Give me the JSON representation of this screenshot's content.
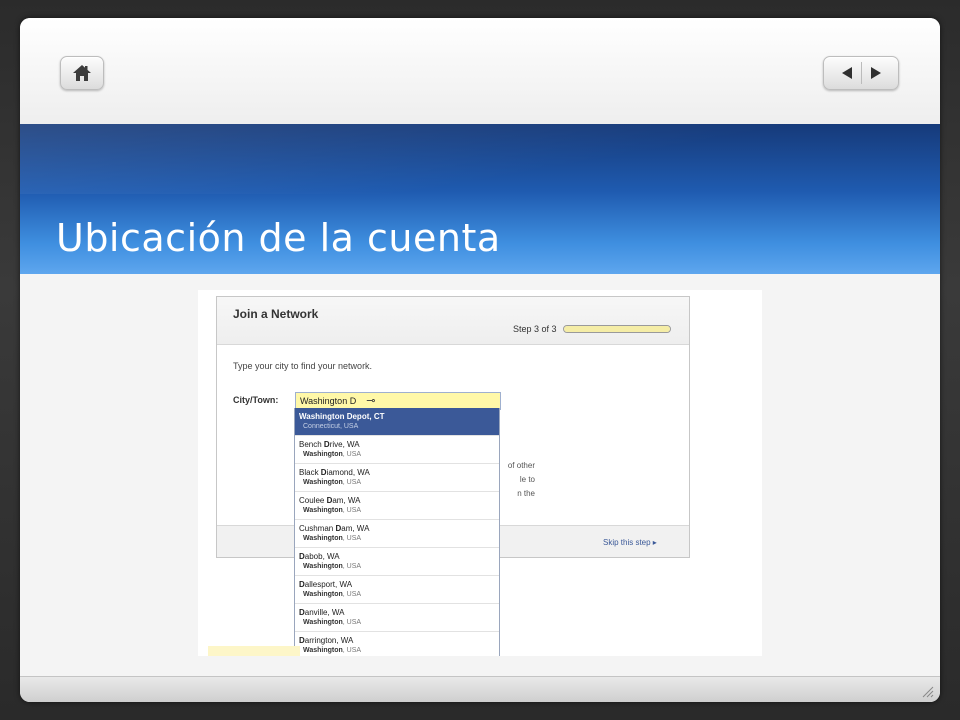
{
  "slide": {
    "title": "Ubicación de la cuenta",
    "colors": {
      "title_band": "#1f5bb0",
      "title_text": "#ffffff",
      "frame": "#2b2b2b"
    }
  },
  "nav": {
    "home_icon": "home-icon",
    "prev_icon": "triangle-left-icon",
    "next_icon": "triangle-right-icon"
  },
  "screenshot": {
    "panel_title": "Join a Network",
    "step_text": "Step 3 of 3",
    "step_progress": 1.0,
    "instruction": "Type your city to find your network.",
    "city_label": "City/Town:",
    "city_value": "Washington D",
    "behind_text": [
      "of other",
      "le to",
      "n the"
    ],
    "skip_label": "Skip this step ▸",
    "suggestions": [
      {
        "name_bold": "Washington D",
        "name_rest": "epot, CT",
        "sub_bold": "",
        "sub_rest": "Connecticut, USA",
        "selected": true
      },
      {
        "name_pre": "Bench ",
        "name_bold": "D",
        "name_rest": "rive, WA",
        "sub_bold": "Washington",
        "sub_rest": ", USA"
      },
      {
        "name_pre": "Black ",
        "name_bold": "D",
        "name_rest": "iamond, WA",
        "sub_bold": "Washington",
        "sub_rest": ", USA"
      },
      {
        "name_pre": "Coulee ",
        "name_bold": "D",
        "name_rest": "am, WA",
        "sub_bold": "Washington",
        "sub_rest": ", USA"
      },
      {
        "name_pre": "Cushman ",
        "name_bold": "D",
        "name_rest": "am, WA",
        "sub_bold": "Washington",
        "sub_rest": ", USA"
      },
      {
        "name_pre": "",
        "name_bold": "D",
        "name_rest": "abob, WA",
        "sub_bold": "Washington",
        "sub_rest": ", USA"
      },
      {
        "name_pre": "",
        "name_bold": "D",
        "name_rest": "allesport, WA",
        "sub_bold": "Washington",
        "sub_rest": ", USA"
      },
      {
        "name_pre": "",
        "name_bold": "D",
        "name_rest": "anville, WA",
        "sub_bold": "Washington",
        "sub_rest": ", USA"
      },
      {
        "name_pre": "",
        "name_bold": "D",
        "name_rest": "arrington, WA",
        "sub_bold": "Washington",
        "sub_rest": ", USA"
      }
    ]
  }
}
